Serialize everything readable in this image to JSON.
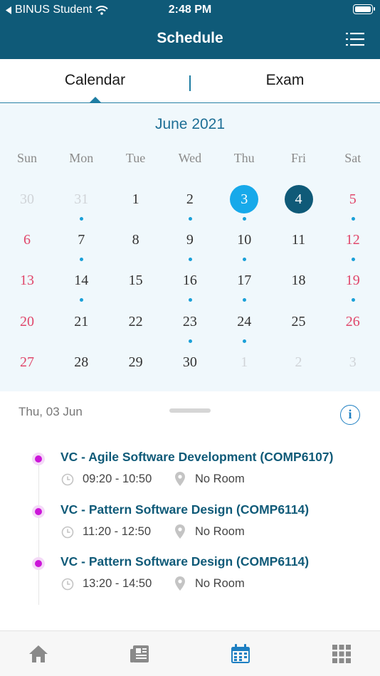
{
  "status_bar": {
    "carrier": "BINUS Student",
    "time": "2:48 PM"
  },
  "header": {
    "title": "Schedule",
    "menu_icon": "list-icon"
  },
  "tabs": [
    {
      "label": "Calendar",
      "active": true
    },
    {
      "label": "Exam",
      "active": false
    }
  ],
  "calendar": {
    "month_label": "June 2021",
    "weekdays": [
      "Sun",
      "Mon",
      "Tue",
      "Wed",
      "Thu",
      "Fri",
      "Sat"
    ],
    "weeks": [
      [
        {
          "d": "30",
          "other": true
        },
        {
          "d": "31",
          "other": true,
          "dot": true
        },
        {
          "d": "1"
        },
        {
          "d": "2",
          "dot": true
        },
        {
          "d": "3",
          "selected": true,
          "dot": true
        },
        {
          "d": "4",
          "today": true
        },
        {
          "d": "5",
          "dot": true
        }
      ],
      [
        {
          "d": "6"
        },
        {
          "d": "7",
          "dot": true
        },
        {
          "d": "8"
        },
        {
          "d": "9",
          "dot": true
        },
        {
          "d": "10",
          "dot": true
        },
        {
          "d": "11"
        },
        {
          "d": "12",
          "dot": true
        }
      ],
      [
        {
          "d": "13"
        },
        {
          "d": "14",
          "dot": true
        },
        {
          "d": "15"
        },
        {
          "d": "16",
          "dot": true
        },
        {
          "d": "17",
          "dot": true
        },
        {
          "d": "18"
        },
        {
          "d": "19",
          "dot": true
        }
      ],
      [
        {
          "d": "20"
        },
        {
          "d": "21"
        },
        {
          "d": "22"
        },
        {
          "d": "23",
          "dot": true
        },
        {
          "d": "24",
          "dot": true
        },
        {
          "d": "25"
        },
        {
          "d": "26"
        }
      ],
      [
        {
          "d": "27"
        },
        {
          "d": "28"
        },
        {
          "d": "29"
        },
        {
          "d": "30"
        },
        {
          "d": "1",
          "other": true
        },
        {
          "d": "2",
          "other": true
        },
        {
          "d": "3",
          "other": true
        }
      ]
    ]
  },
  "schedule": {
    "date_label": "Thu, 03 Jun",
    "events": [
      {
        "title": "VC - Agile Software Development (COMP6107)",
        "time": "09:20 - 10:50",
        "room": "No Room"
      },
      {
        "title": "VC - Pattern Software Design (COMP6114)",
        "time": "11:20 - 12:50",
        "room": "No Room"
      },
      {
        "title": "VC - Pattern Software Design (COMP6114)",
        "time": "13:20 - 14:50",
        "room": "No Room"
      }
    ]
  },
  "bottom_nav": [
    {
      "icon": "home-icon",
      "active": false
    },
    {
      "icon": "news-icon",
      "active": false
    },
    {
      "icon": "calendar-icon",
      "active": true
    },
    {
      "icon": "apps-grid-icon",
      "active": false
    }
  ],
  "colors": {
    "primary": "#0f5a78",
    "selected_day": "#17a9ea",
    "weekend": "#e0466a",
    "event_marker": "#cc16d9",
    "nav_active": "#1e7fc2",
    "nav_inactive": "#8a8a8a"
  }
}
